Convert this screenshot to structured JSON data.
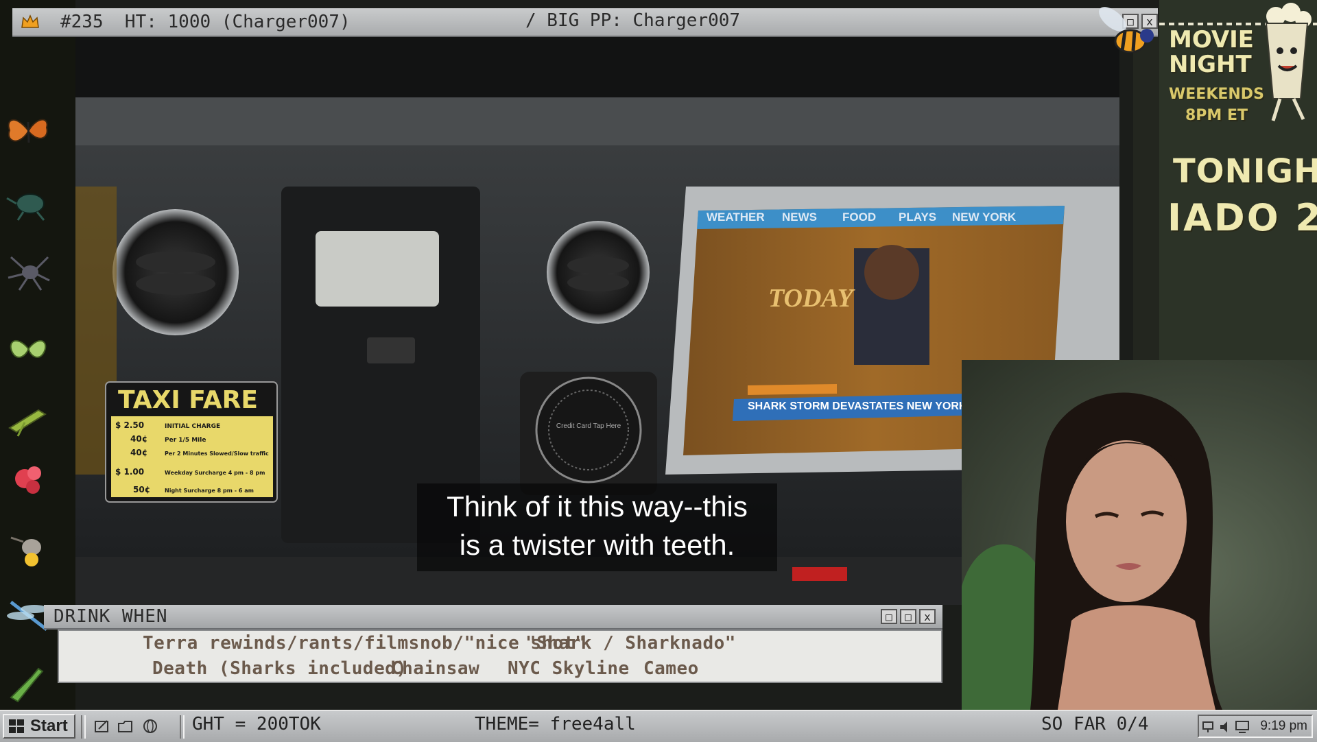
{
  "title_bar": {
    "left_text": "#235  HT: 1000 (Charger007)",
    "right_text": "/ BIG PP: Charger007",
    "window_buttons": [
      "□",
      "x"
    ]
  },
  "video": {
    "subtitle_line1": "Think of it this way--this",
    "subtitle_line2": "is a twister with teeth.",
    "taxi_sign": {
      "title": "TAXI FARE",
      "rows": [
        {
          "price": "$ 2.50",
          "desc": "INITIAL CHARGE"
        },
        {
          "price": "40¢",
          "desc": "Per 1/5 Mile"
        },
        {
          "price": "40¢",
          "desc": "Per 2 Minutes Slowed/Slow traffic"
        },
        {
          "price": "$ 1.00",
          "desc": "Weekday Surcharge 4 pm - 8 pm"
        },
        {
          "price": "50¢",
          "desc": "Night Surcharge 8 pm - 6 am"
        }
      ]
    },
    "card_reader_text": "Credit Card Tap Here",
    "screen": {
      "nav_items": [
        "WEATHER",
        "NEWS",
        "FOOD",
        "PLAYS",
        "NEW YORK"
      ],
      "show_logo": "TODAY",
      "ticker": "SHARK STORM DEVASTATES NEW YORK"
    }
  },
  "poster": {
    "line1": "MOVIE",
    "line2": "NIGHT",
    "line3": "WEEKENDS",
    "line4": "8PM ET",
    "tonight_label": "TONIGHT:",
    "tonight_title": "IADO 2"
  },
  "drink_panel": {
    "title": "DRINK WHEN",
    "buttons": [
      "□",
      "□",
      "x"
    ],
    "row1": [
      "Terra rewinds/rants/filmsnob/\"nice shot\"",
      "\"Shark / Sharknado\""
    ],
    "row2": [
      "Death (Sharks included)",
      "Chainsaw",
      "NYC Skyline",
      "Cameo"
    ]
  },
  "taskbar": {
    "start_label": "Start",
    "status_left": "GHT = 200TOK",
    "status_theme": "THEME= free4all",
    "status_sofar": "SO FAR 0/4",
    "clock": "9:19 pm"
  },
  "colors": {
    "bar_gray": "#b7b9bb",
    "drink_text": "#6b5a4c",
    "taxi_yellow": "#e8d86a",
    "poster_text": "#efe9b0"
  }
}
